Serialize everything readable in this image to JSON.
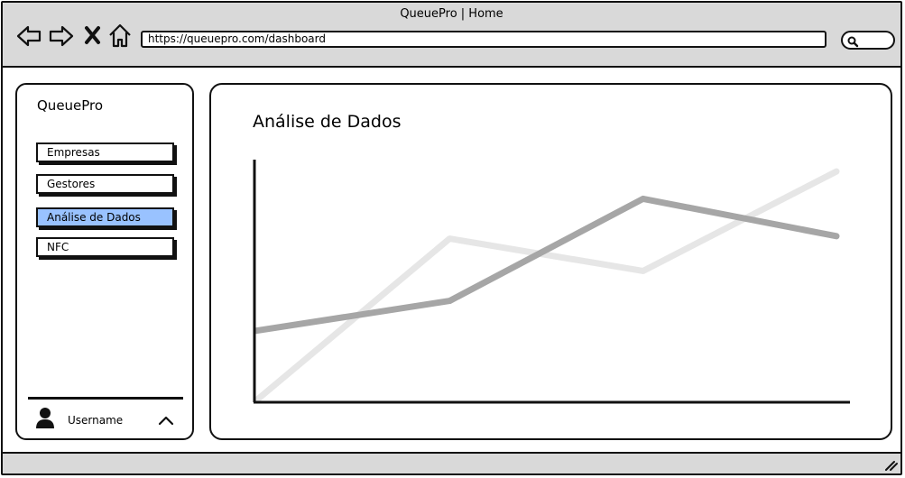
{
  "window": {
    "title": "QueuePro | Home"
  },
  "browser": {
    "url": "https://queuepro.com/dashboard"
  },
  "sidebar": {
    "brand": "QueuePro",
    "items": [
      {
        "label": "Empresas",
        "active": false
      },
      {
        "label": "Gestores",
        "active": false
      },
      {
        "label": "Análise de Dados",
        "active": true
      },
      {
        "label": "NFC",
        "active": false
      }
    ],
    "user": {
      "name": "Username"
    }
  },
  "main": {
    "title": "Análise de Dados"
  },
  "colors": {
    "active_nav": "#99c2ff",
    "series_dark": "#a6a6a6",
    "series_light": "#e6e6e6"
  },
  "chart_data": {
    "type": "line",
    "title": "",
    "x": [
      0,
      1,
      2,
      3,
      4
    ],
    "ylim": [
      0,
      100
    ],
    "series": [
      {
        "color": "#e6e6e6",
        "values": [
          0,
          65,
          52,
          92
        ]
      },
      {
        "color": "#a6a6a6",
        "values": [
          28,
          40,
          81,
          66
        ]
      }
    ],
    "series_x": [
      [
        0,
        1,
        2,
        3
      ],
      [
        0,
        1,
        2,
        3
      ]
    ],
    "grid": false,
    "legend": "none"
  }
}
